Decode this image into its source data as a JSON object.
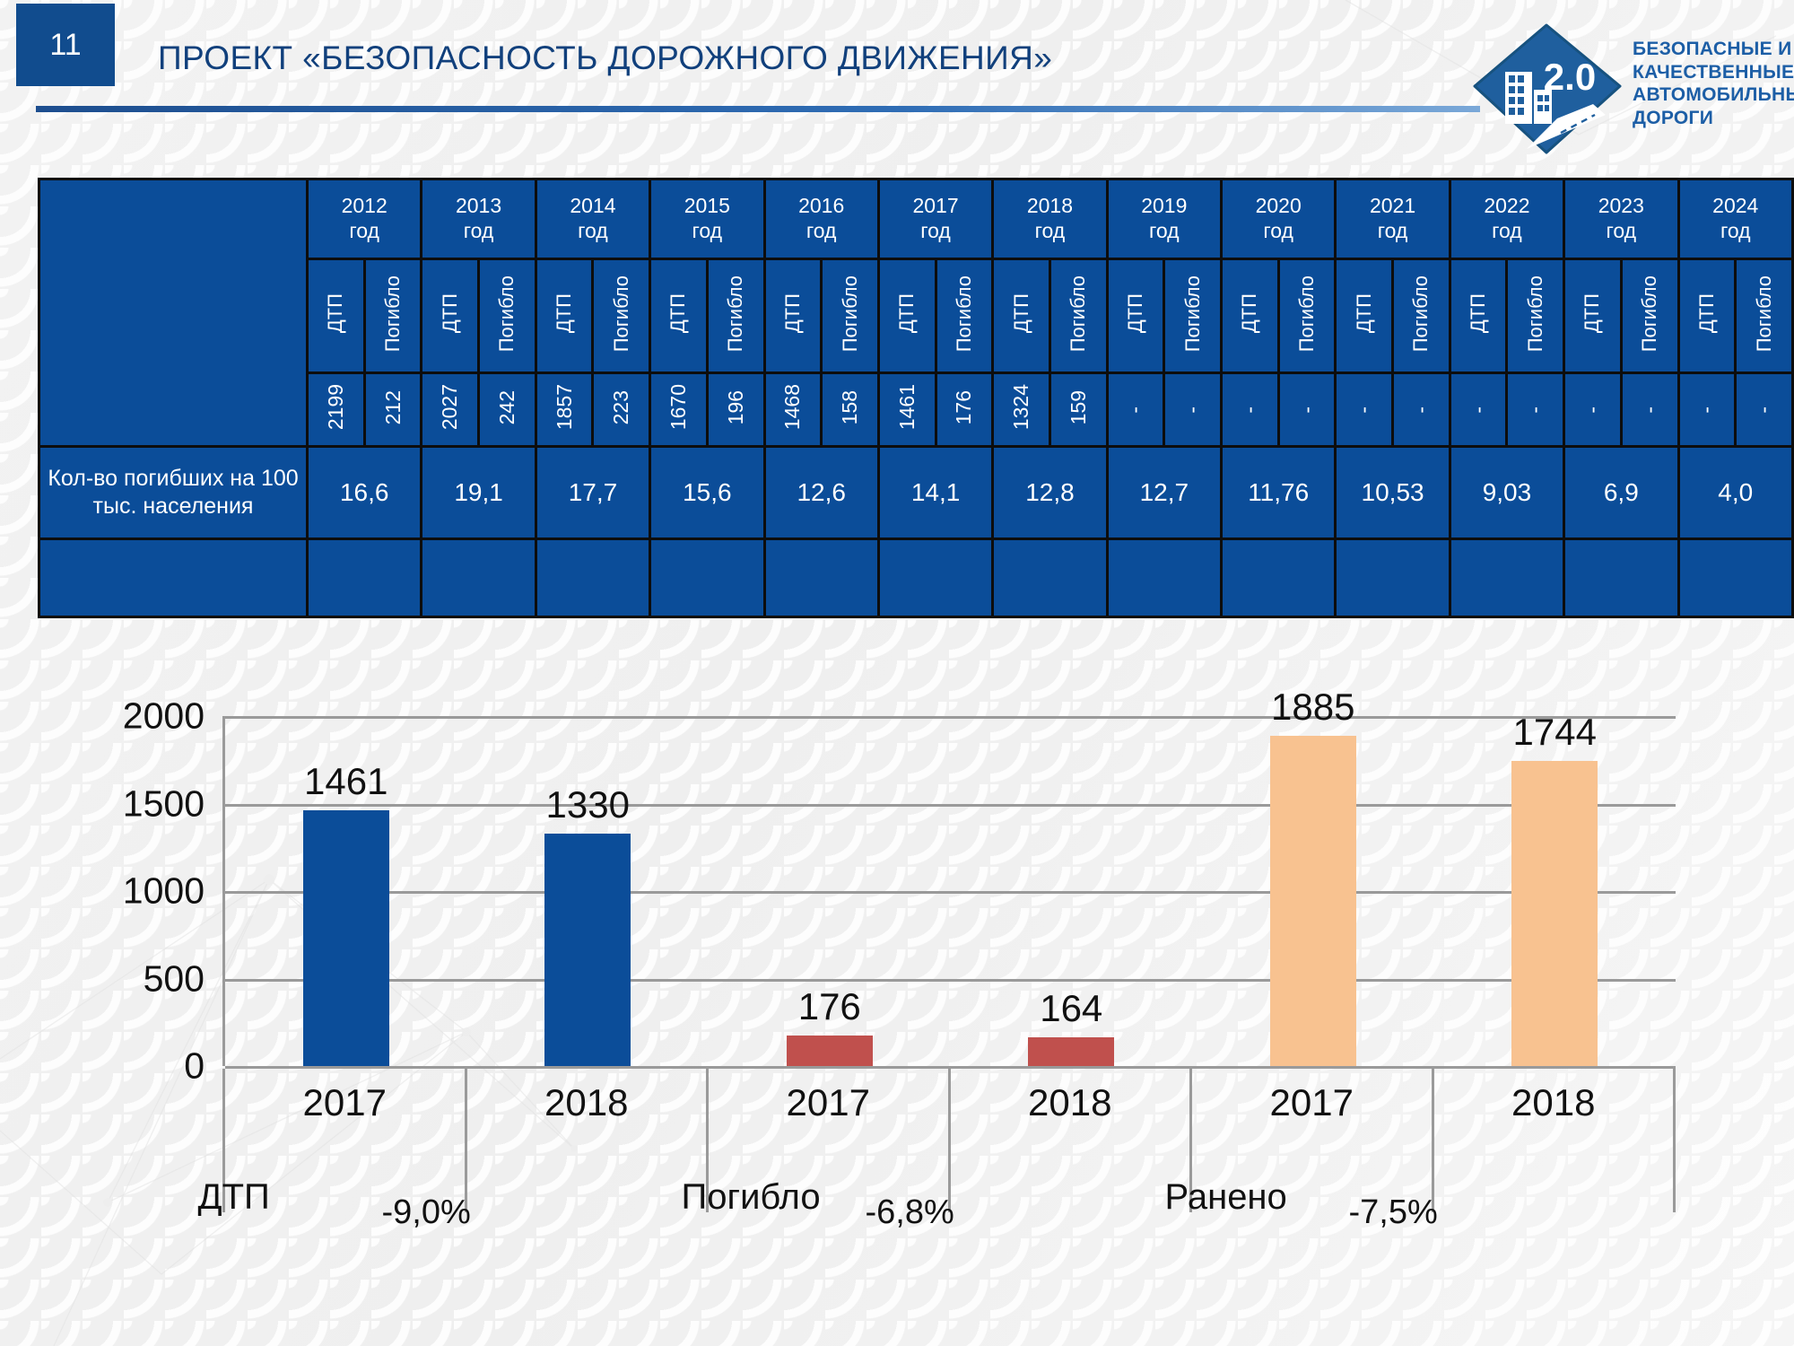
{
  "header": {
    "page_number": "11",
    "title": "ПРОЕКТ «БЕЗОПАСНОСТЬ ДОРОЖНОГО ДВИЖЕНИЯ»",
    "accent_color": "#114c8e"
  },
  "logo": {
    "icon_name": "bkad-road-logo",
    "version_text": "2.0",
    "line1": "БЕЗОПАСНЫЕ И",
    "line2": "КАЧЕСТВЕННЫЕ",
    "line3": "АВТОМОБИЛЬНЫЕ",
    "line4": "ДОРОГИ",
    "color": "#1c5ea6"
  },
  "table": {
    "fill_color": "#0b4d99",
    "years": [
      "2012\nгод",
      "2013\nгод",
      "2014\nгод",
      "2015\nгод",
      "2016\nгод",
      "2017\nгод",
      "2018\nгод",
      "2019\nгод",
      "2020\nгод",
      "2021\nгод",
      "2022\nгод",
      "2023\nгод",
      "2024\nгод"
    ],
    "years_flat": [
      "2012",
      "2013",
      "2014",
      "2015",
      "2016",
      "2017",
      "2018",
      "2019",
      "2020",
      "2021",
      "2022",
      "2023",
      "2024"
    ],
    "year_suffix": "год",
    "sub_headers": [
      "ДТП",
      "Погибло"
    ],
    "values": [
      "2199",
      "212",
      "2027",
      "242",
      "1857",
      "223",
      "1670",
      "196",
      "1468",
      "158",
      "1461",
      "176",
      "1324",
      "159",
      "-",
      "-",
      "-",
      "-",
      "-",
      "-",
      "-",
      "-",
      "-",
      "-",
      "-",
      "-"
    ],
    "row_label": "Кол-во погибших на 100 тыс. населения",
    "per_100k": [
      "16,6",
      "19,1",
      "17,7",
      "15,6",
      "12,6",
      "14,1",
      "12,8",
      "12,7",
      "11,76",
      "10,53",
      "9,03",
      "6,9",
      "4,0"
    ]
  },
  "chart_data": {
    "type": "bar",
    "title": "",
    "xlabel": "",
    "ylabel": "",
    "ylim": [
      0,
      2000
    ],
    "yticks": [
      "2000",
      "1500",
      "1000",
      "500",
      "0"
    ],
    "ytick_values": [
      2000,
      1500,
      1000,
      500,
      0
    ],
    "grid": true,
    "legend_position": "none",
    "categories": [
      "2017",
      "2018",
      "2017",
      "2018",
      "2017",
      "2018"
    ],
    "values": [
      1461,
      1330,
      176,
      164,
      1885,
      1744
    ],
    "colors": [
      "#0b4d99",
      "#0b4d99",
      "#c0504d",
      "#c0504d",
      "#f8c290",
      "#f8c290"
    ],
    "groups": [
      {
        "name": "ДТП",
        "percent": "-9,0%",
        "years": [
          "2017",
          "2018"
        ],
        "values": [
          1461,
          1330
        ],
        "color": "#0b4d99"
      },
      {
        "name": "Погибло",
        "percent": "-6,8%",
        "years": [
          "2017",
          "2018"
        ],
        "values": [
          176,
          164
        ],
        "color": "#c0504d"
      },
      {
        "name": "Ранено",
        "percent": "-7,5%",
        "years": [
          "2017",
          "2018"
        ],
        "values": [
          1885,
          1744
        ],
        "color": "#f8c290"
      }
    ]
  }
}
